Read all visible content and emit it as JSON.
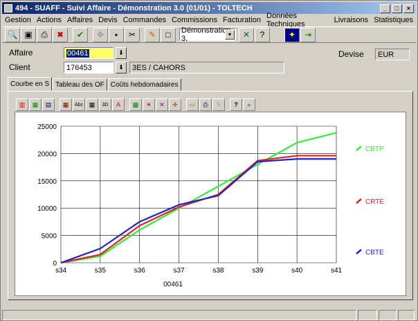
{
  "window": {
    "title": "494 - SUAFF - Suivi Affaire - Démonstration 3.0 (01/01) - TOLTECH"
  },
  "menu": [
    "Gestion",
    "Actions",
    "Affaires",
    "Devis",
    "Commandes",
    "Commissions",
    "Facturation",
    "Données Techniques",
    "Livraisons",
    "Statistiques"
  ],
  "toolbar": {
    "company_select": "Démonstration 3."
  },
  "form": {
    "affaire_label": "Affaire",
    "affaire_value": "00461",
    "client_label": "Client",
    "client_code": "176453",
    "client_name": "3ES / CAHORS",
    "devise_label": "Devise",
    "devise_value": "EUR"
  },
  "tabs": [
    "Courbe en S",
    "Tableau des OF",
    "Coûts hebdomadaires"
  ],
  "chart_data": {
    "type": "line",
    "x": [
      "s34",
      "s35",
      "s36",
      "s37",
      "s38",
      "s39",
      "s40",
      "s41"
    ],
    "xlabel": "00461",
    "ylim": [
      0,
      25000
    ],
    "yticks": [
      0,
      5000,
      10000,
      15000,
      20000,
      25000
    ],
    "series": [
      {
        "name": "CBTP",
        "color": "#33ee33",
        "values": [
          0,
          1200,
          6000,
          10000,
          14000,
          18000,
          22000,
          23800
        ]
      },
      {
        "name": "CRTE",
        "color": "#dd2222",
        "values": [
          0,
          1500,
          6800,
          10200,
          12500,
          18700,
          19600,
          19600
        ]
      },
      {
        "name": "CBTE",
        "color": "#2222cc",
        "values": [
          0,
          2600,
          7500,
          10600,
          12300,
          18500,
          19000,
          19000
        ]
      }
    ]
  }
}
